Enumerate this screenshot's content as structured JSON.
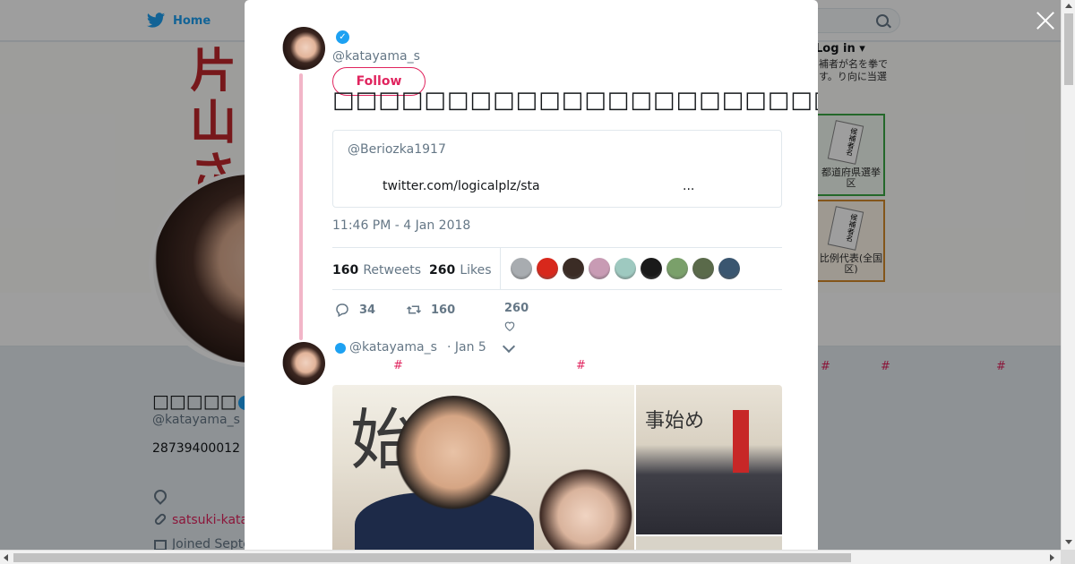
{
  "nav": {
    "home_label": "Home",
    "login_label": "Log in"
  },
  "banner": {
    "name_text": "片山さ",
    "login_note": "補者が名を拳です。り向に当選",
    "ballot_1_label": "都道府県選挙区",
    "ballot_2_label": "比例代表(全国区)",
    "ballot_card_text": "候補者名"
  },
  "profile": {
    "name": "□□□□□",
    "handle": "@katayama_s",
    "bio": "28739400012",
    "url": "satsuki-kata",
    "joined": "Joined Septe"
  },
  "tweet": {
    "handle": "@katayama_s",
    "follow_label": "Follow",
    "text": "□□□□□□□□□□□□□□□□□□□□□□□□□□□□□□□□□□□□□□□□□□□□□□",
    "quote_handle": "@Beriozka1917",
    "quote_link": "twitter.com/logicalplz/sta",
    "quote_ellipsis": "...",
    "timestamp": "11:46 PM - 4 Jan 2018",
    "retweets_count": "160",
    "retweets_label": "Retweets",
    "likes_count": "260",
    "likes_label": "Likes",
    "liker_colors": [
      "#a8acb0",
      "#d8281c",
      "#3b2c25",
      "#c89bb4",
      "#9ec9c0",
      "#1a1a1a",
      "#7aa06a",
      "#5a6a4a",
      "#3a5670"
    ],
    "reply_count": "34",
    "retweet_count": "160",
    "like_count": "260"
  },
  "next_tweet": {
    "handle": "@katayama_s",
    "date": "· Jan 5",
    "hash_1": "#",
    "hash_2": "#",
    "photo_calligraphy": "始",
    "photo_calligraphy_2": "事始め"
  },
  "background_hashes": [
    "#",
    "#",
    "#"
  ],
  "colors": {
    "accent": "#e0245e",
    "twitter_blue": "#1da1f2",
    "thread_line": "#f2b6c8"
  }
}
